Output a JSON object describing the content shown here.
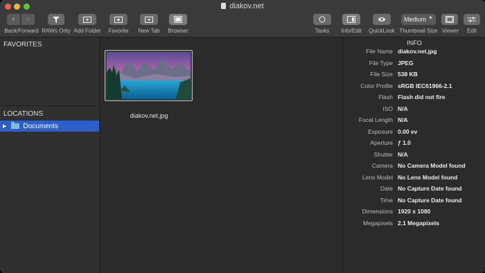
{
  "window": {
    "title": "diakov.net"
  },
  "toolbar": {
    "back_forward": "Back/Forward",
    "raws_only": "RAWs Only",
    "add_folder": "Add Folder",
    "favorite": "Favorite",
    "new_tab": "New Tab",
    "browser": "Browser",
    "tasks": "Tasks",
    "info_edit": "Info/Edit",
    "quicklook": "QuickLook",
    "thumbnail_size_label": "Thumbnail Size",
    "thumbnail_size_value": "Medium",
    "viewer": "Viewer",
    "edit": "Edit"
  },
  "sidebar": {
    "favorites": "FAVORITES",
    "locations": "LOCATIONS",
    "items": [
      {
        "label": "Documents"
      }
    ]
  },
  "browser": {
    "files": [
      {
        "name": "diakov.net.jpg"
      }
    ]
  },
  "info": {
    "title": "INFO",
    "rows": [
      {
        "key": "File Name",
        "value": "diakov.net.jpg"
      },
      {
        "key": "File Type",
        "value": "JPEG"
      },
      {
        "key": "File Size",
        "value": "538 KB"
      },
      {
        "key": "Color Profile",
        "value": "sRGB IEC61966-2.1"
      },
      {
        "key": "Flash",
        "value": "Flash did not fire"
      },
      {
        "key": "ISO",
        "value": "N/A"
      },
      {
        "key": "Focal Length",
        "value": "N/A"
      },
      {
        "key": "Exposure",
        "value": "0.00 ev"
      },
      {
        "key": "Aperture",
        "value": "ƒ 1.0"
      },
      {
        "key": "Shutter",
        "value": "N/A"
      },
      {
        "key": "Camera",
        "value": "No Camera Model found"
      },
      {
        "key": "Lens Model",
        "value": "No Lens Model found"
      },
      {
        "key": "Date",
        "value": "No Capture Date found"
      },
      {
        "key": "Time",
        "value": "No Capture Date found"
      },
      {
        "key": "Dimensions",
        "value": "1920 x 1080"
      },
      {
        "key": "Megapixels",
        "value": "2.1 Megapixels"
      }
    ]
  }
}
